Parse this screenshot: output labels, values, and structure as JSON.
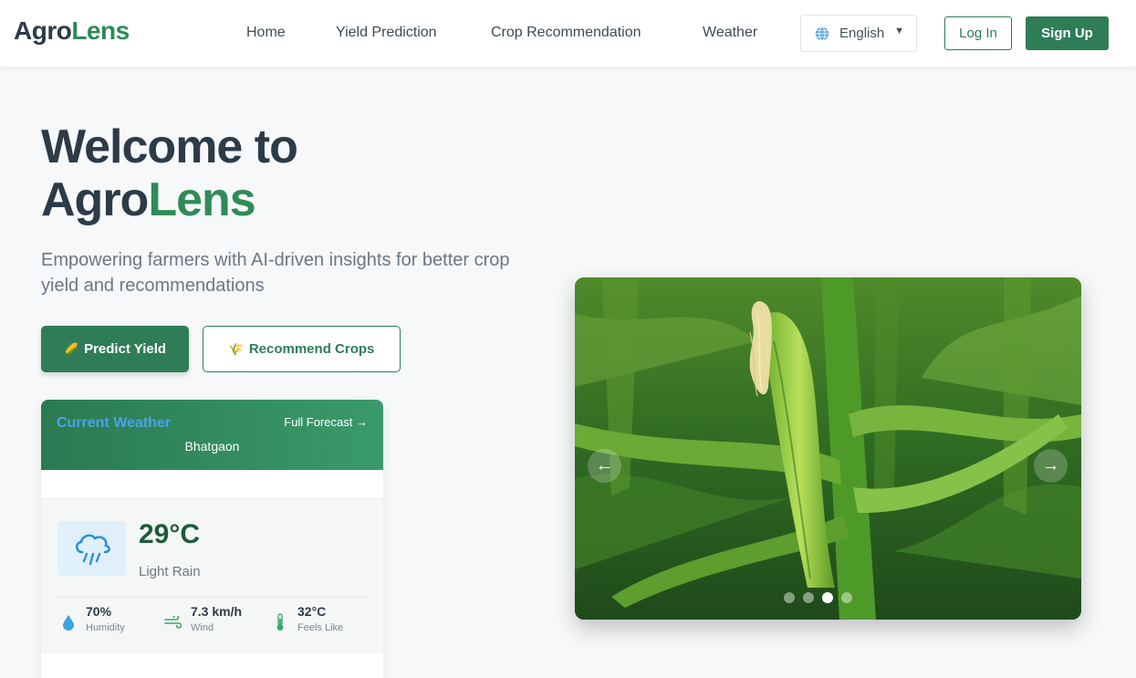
{
  "brand": {
    "part1": "Agro",
    "part2": "Lens"
  },
  "nav": {
    "items": [
      {
        "label": "Home"
      },
      {
        "label": "Yield Prediction"
      },
      {
        "label": "Crop Recommendation"
      },
      {
        "label": "Weather"
      }
    ]
  },
  "language": {
    "selected": "English",
    "icon": "globe-icon"
  },
  "auth": {
    "login_label": "Log In",
    "signup_label": "Sign Up"
  },
  "hero": {
    "title_line1": "Welcome to",
    "title_part1": "Agro",
    "title_part2": "Lens",
    "subtitle": "Empowering farmers with AI-driven insights for better crop yield and recommendations",
    "predict_label": "Predict Yield",
    "predict_icon": "corn-icon",
    "recommend_label": "Recommend Crops",
    "recommend_icon": "wheat-icon"
  },
  "weather": {
    "title": "Current Weather",
    "forecast_link": "Full Forecast →",
    "location": "Bhatgaon",
    "temperature": "29°C",
    "condition": "Light Rain",
    "condition_icon": "rain-cloud-icon",
    "stats": [
      {
        "value": "70%",
        "label": "Humidity",
        "icon": "droplet-icon"
      },
      {
        "value": "7.3 km/h",
        "label": "Wind",
        "icon": "wind-icon"
      },
      {
        "value": "32°C",
        "label": "Feels Like",
        "icon": "thermometer-icon"
      }
    ]
  },
  "carousel": {
    "prev_icon": "arrow-left-icon",
    "next_icon": "arrow-right-icon",
    "prev_glyph": "←",
    "next_glyph": "→",
    "slide_count": 4,
    "active_index": 2
  },
  "colors": {
    "brand_green": "#2e7d57",
    "accent_green": "#2e8b57",
    "weather_title_blue": "#4aa3e8",
    "dark_text": "#2d3b48"
  }
}
